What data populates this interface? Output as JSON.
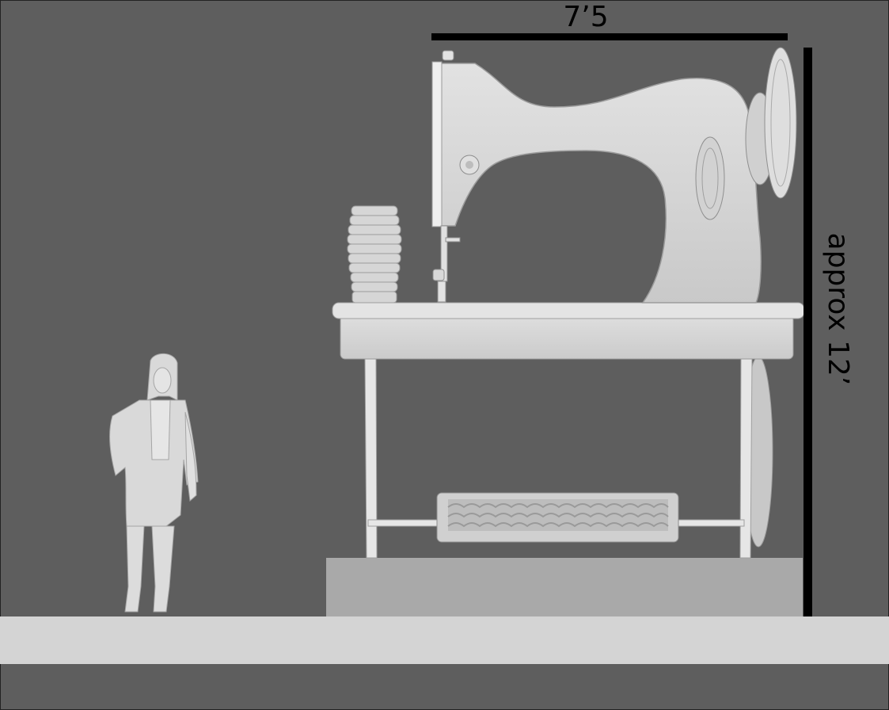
{
  "dimensions": {
    "width_label": "7’5",
    "height_label": "approx 12’"
  },
  "colors": {
    "background": "#5e5e5e",
    "floor": "#d4d4d4",
    "plinth": "#a8a8a8",
    "model": "#d8d8d8",
    "dimension_line": "#000000"
  }
}
